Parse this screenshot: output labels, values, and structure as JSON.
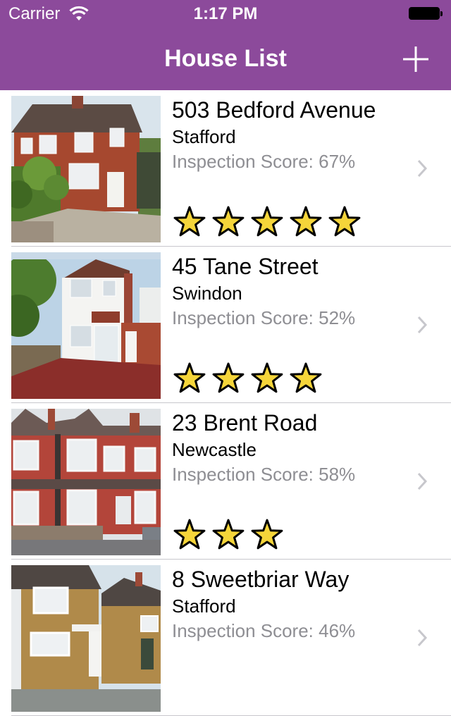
{
  "status_bar": {
    "carrier": "Carrier",
    "time": "1:17 PM"
  },
  "nav": {
    "title": "House List",
    "add_icon": "plus-icon"
  },
  "colors": {
    "header": "#8c4a9b",
    "star_fill": "#f5d53a",
    "secondary_text": "#8e8e93"
  },
  "houses": [
    {
      "address": "503 Bedford Avenue",
      "town": "Stafford",
      "score": "Inspection Score: 67%",
      "stars": 5
    },
    {
      "address": "45 Tane Street",
      "town": "Swindon",
      "score": "Inspection Score: 52%",
      "stars": 4
    },
    {
      "address": "23 Brent Road",
      "town": "Newcastle",
      "score": "Inspection Score: 58%",
      "stars": 3
    },
    {
      "address": "8 Sweetbriar Way",
      "town": "Stafford",
      "score": "Inspection Score: 46%",
      "stars": 0
    }
  ]
}
